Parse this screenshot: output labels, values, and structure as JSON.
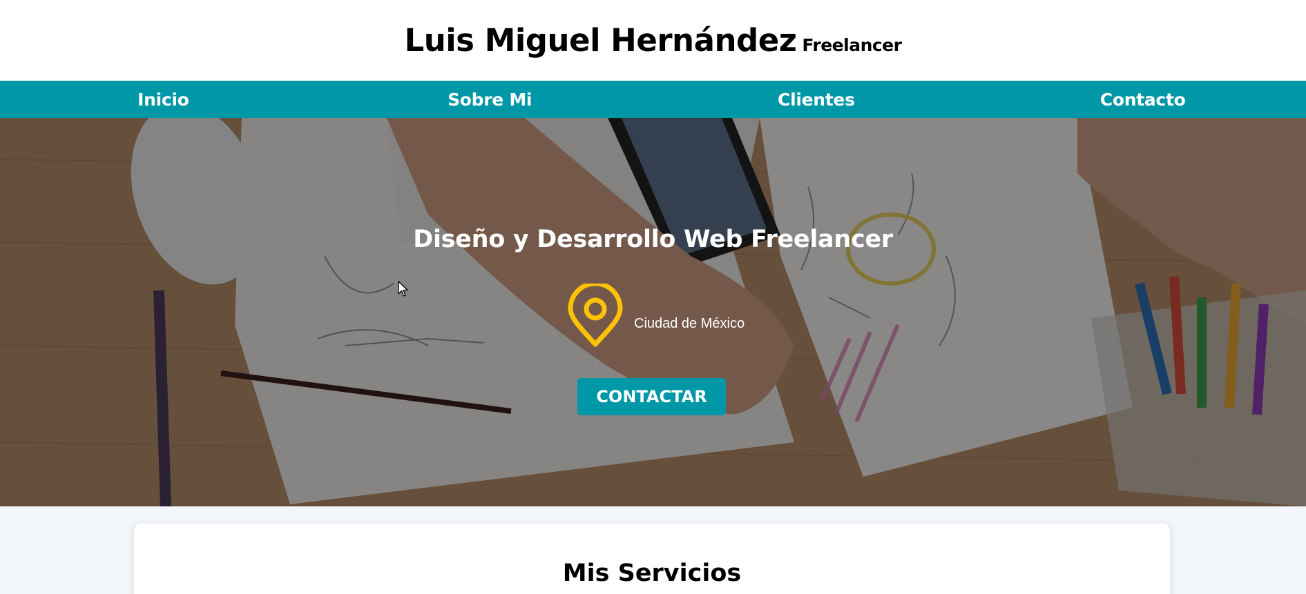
{
  "header": {
    "name": "Luis Miguel Hernández",
    "subtitle": "Freelancer"
  },
  "nav": {
    "items": [
      {
        "label": "Inicio"
      },
      {
        "label": "Sobre Mi"
      },
      {
        "label": "Clientes"
      },
      {
        "label": "Contacto"
      }
    ]
  },
  "hero": {
    "title": "Diseño y Desarrollo Web Freelancer",
    "location": "Ciudad de México",
    "location_icon": "map-pin-icon",
    "cta_label": "CONTACTAR"
  },
  "services": {
    "title": "Mis Servicios"
  },
  "colors": {
    "accent": "#0097a7",
    "pin": "#ffc107"
  }
}
